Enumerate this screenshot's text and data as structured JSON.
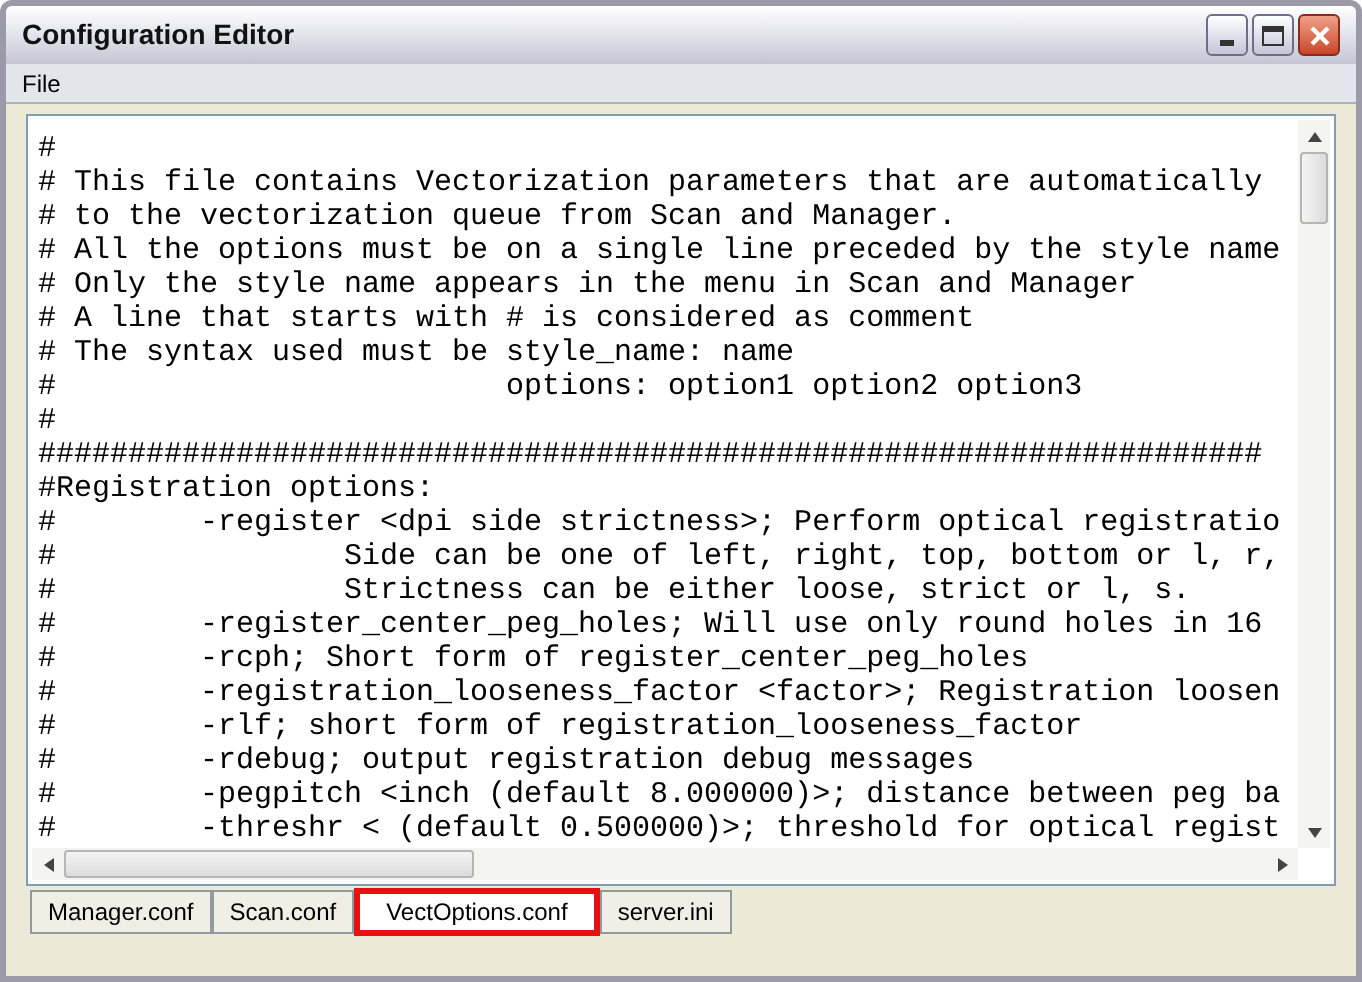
{
  "window": {
    "title": "Configuration Editor"
  },
  "menu": [
    "File"
  ],
  "editor": {
    "lines": [
      "#",
      "# This file contains Vectorization parameters that are automatically",
      "# to the vectorization queue from Scan and Manager.",
      "# All the options must be on a single line preceded by the style name",
      "# Only the style name appears in the menu in Scan and Manager",
      "# A line that starts with # is considered as comment",
      "# The syntax used must be style_name: name",
      "#                         options: option1 option2 option3",
      "#",
      "####################################################################",
      "#Registration options:",
      "#        -register <dpi side strictness>; Perform optical registratio",
      "#                Side can be one of left, right, top, bottom or l, r,",
      "#                Strictness can be either loose, strict or l, s.",
      "#        -register_center_peg_holes; Will use only round holes in 16",
      "#        -rcph; Short form of register_center_peg_holes",
      "#        -registration_looseness_factor <factor>; Registration loosen",
      "#        -rlf; short form of registration_looseness_factor",
      "#        -rdebug; output registration debug messages",
      "#        -pegpitch <inch (default 8.000000)>; distance between peg ba",
      "#        -threshr < (default 0.500000)>; threshold for optical regist"
    ]
  },
  "tabs": [
    {
      "label": "Manager.conf",
      "selected": false,
      "highlighted": false
    },
    {
      "label": "Scan.conf",
      "selected": false,
      "highlighted": false
    },
    {
      "label": "VectOptions.conf",
      "selected": true,
      "highlighted": true
    },
    {
      "label": "server.ini",
      "selected": false,
      "highlighted": false
    }
  ]
}
